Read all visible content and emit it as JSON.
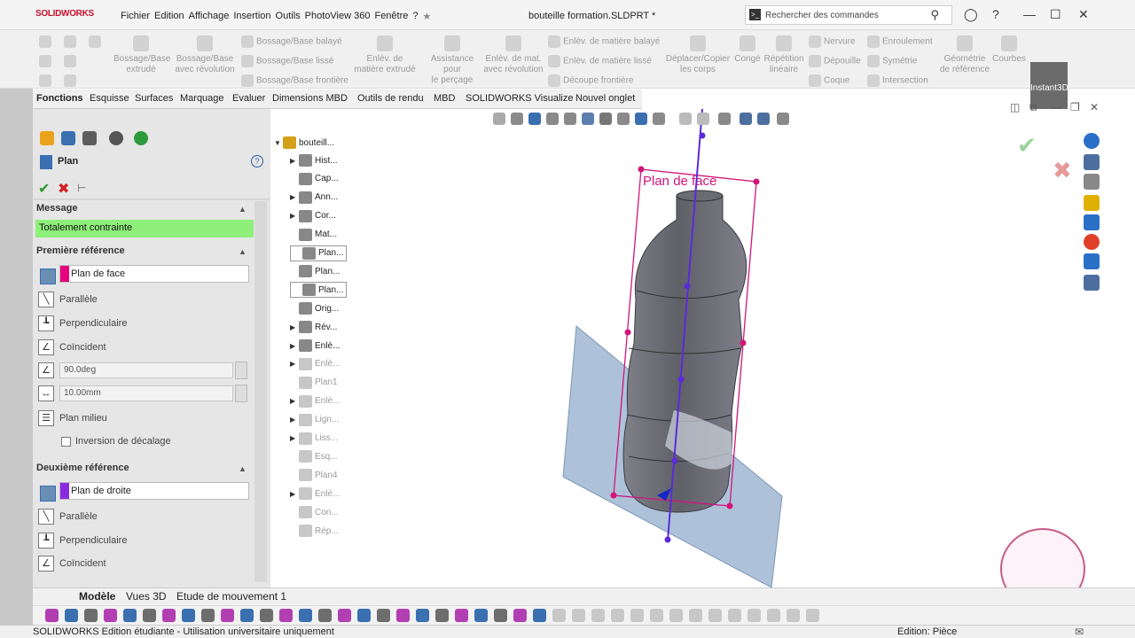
{
  "app": {
    "logo": "SOLIDWORKS",
    "title": "bouteille formation.SLDPRT *"
  },
  "menu": [
    "Fichier",
    "Edition",
    "Affichage",
    "Insertion",
    "Outils",
    "PhotoView 360",
    "Fenêtre",
    "?"
  ],
  "search": {
    "placeholder": "Rechercher des commandes"
  },
  "toolbar": {
    "items": [
      {
        "label1": "Bossage/Base",
        "label2": "extrudé"
      },
      {
        "label1": "Bossage/Base",
        "label2": "avec révolution"
      },
      {
        "label1": "Bossage/Base balayé",
        "label2": ""
      },
      {
        "label1": "Bossage/Base lissé",
        "label2": ""
      },
      {
        "label1": "Bossage/Base frontière",
        "label2": ""
      },
      {
        "label1": "Enlèv. de",
        "label2": "matière extrudé"
      },
      {
        "label1": "Assistance pour",
        "label2": "le perçage"
      },
      {
        "label1": "Enlèv. de mat.",
        "label2": "avec révolution"
      },
      {
        "label1": "Enlèv. de matière balayé",
        "label2": ""
      },
      {
        "label1": "Enlèv. de matière lissé",
        "label2": ""
      },
      {
        "label1": "Découpe frontière",
        "label2": ""
      },
      {
        "label1": "Déplacer/Copier",
        "label2": "les corps"
      },
      {
        "label1": "Congé",
        "label2": ""
      },
      {
        "label1": "Répétition",
        "label2": "linéaire"
      },
      {
        "label1": "Nervure",
        "label2": ""
      },
      {
        "label1": "Dépouille",
        "label2": ""
      },
      {
        "label1": "Coque",
        "label2": ""
      },
      {
        "label1": "Enroulement",
        "label2": ""
      },
      {
        "label1": "Symétrie",
        "label2": ""
      },
      {
        "label1": "Intersection",
        "label2": ""
      },
      {
        "label1": "Géométrie",
        "label2": "de référence"
      },
      {
        "label1": "Courbes",
        "label2": ""
      }
    ],
    "instant3d": "Instant3D"
  },
  "tabs": [
    "Fonctions",
    "Esquisse",
    "Surfaces",
    "Marquage",
    "Evaluer",
    "Dimensions MBD",
    "Outils de rendu",
    "MBD",
    "SOLIDWORKS Visualize",
    "Nouvel onglet"
  ],
  "panel": {
    "title": "Plan",
    "message_header": "Message",
    "message": "Totalement contrainte",
    "first_ref_header": "Première référence",
    "first_ref_value": "Plan de face",
    "first_ref_color": "#e6007e",
    "options1": [
      "Parallèle",
      "Perpendiculaire",
      "Coïncident"
    ],
    "angle": "90.0deg",
    "distance": "10.00mm",
    "mid_plane": "Plan milieu",
    "flip_offset": "Inversion de décalage",
    "second_ref_header": "Deuxième référence",
    "second_ref_value": "Plan de droite",
    "second_ref_color": "#8a2be2",
    "options2": [
      "Parallèle",
      "Perpendiculaire",
      "Coïncident"
    ]
  },
  "tree": {
    "root": "bouteill...",
    "items": [
      {
        "label": "Hist...",
        "arrow": true,
        "grey": false,
        "box": false
      },
      {
        "label": "Cap...",
        "arrow": false,
        "grey": false,
        "box": false
      },
      {
        "label": "Ann...",
        "arrow": true,
        "grey": false,
        "box": false
      },
      {
        "label": "Cor...",
        "arrow": true,
        "grey": false,
        "box": false
      },
      {
        "label": "Mat...",
        "arrow": false,
        "grey": false,
        "box": false
      },
      {
        "label": "Plan...",
        "arrow": false,
        "grey": false,
        "box": true
      },
      {
        "label": "Plan...",
        "arrow": false,
        "grey": false,
        "box": false
      },
      {
        "label": "Plan...",
        "arrow": false,
        "grey": false,
        "box": true
      },
      {
        "label": "Orig...",
        "arrow": false,
        "grey": false,
        "box": false
      },
      {
        "label": "Rév...",
        "arrow": true,
        "grey": false,
        "box": false
      },
      {
        "label": "Enlè...",
        "arrow": true,
        "grey": false,
        "box": false
      },
      {
        "label": "Enlè...",
        "arrow": true,
        "grey": true,
        "box": false
      },
      {
        "label": "Plan1",
        "arrow": false,
        "grey": true,
        "box": false
      },
      {
        "label": "Enlè...",
        "arrow": true,
        "grey": true,
        "box": false
      },
      {
        "label": "Lign...",
        "arrow": true,
        "grey": true,
        "box": false
      },
      {
        "label": "Liss...",
        "arrow": true,
        "grey": true,
        "box": false
      },
      {
        "label": "Esq...",
        "arrow": false,
        "grey": true,
        "box": false
      },
      {
        "label": "Plan4",
        "arrow": false,
        "grey": true,
        "box": false
      },
      {
        "label": "Enlè...",
        "arrow": true,
        "grey": true,
        "box": false
      },
      {
        "label": "Con...",
        "arrow": false,
        "grey": true,
        "box": false
      },
      {
        "label": "Rép...",
        "arrow": false,
        "grey": true,
        "box": false
      }
    ]
  },
  "viewport": {
    "plane_label": "Plan de face"
  },
  "bottom_tabs": [
    "Modèle",
    "Vues 3D",
    "Etude de mouvement 1"
  ],
  "status": {
    "left": "SOLIDWORKS Edition étudiante - Utilisation universitaire uniquement",
    "right": "Edition: Pièce"
  }
}
